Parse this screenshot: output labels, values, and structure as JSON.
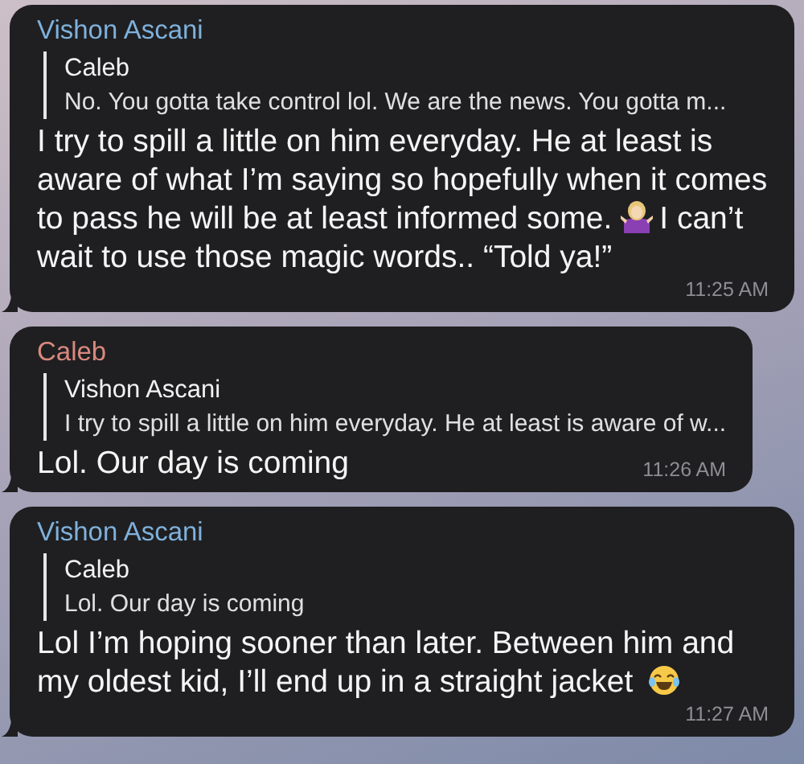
{
  "messages": [
    {
      "sender": {
        "name": "Vishon Ascani",
        "color": "#7fb1dc"
      },
      "reply": {
        "author": "Caleb",
        "text": "No. You gotta take control lol. We are the news. You gotta m..."
      },
      "body": [
        {
          "kind": "text",
          "text": "I try to spill a little on him everyday. He at least is aware of what I’m saying so hopefully when it comes to pass he will be at least informed some."
        },
        {
          "kind": "shrug"
        },
        {
          "kind": "text",
          "text": "I can’t wait to use those magic words.. “Told ya!”"
        }
      ],
      "time": "11:25 AM"
    },
    {
      "sender": {
        "name": "Caleb",
        "color": "#d9897e"
      },
      "reply": {
        "author": "Vishon Ascani",
        "text": "I try to spill a little on him everyday. He at least is aware of w..."
      },
      "body": [
        {
          "kind": "text",
          "text": "Lol. Our day is coming"
        }
      ],
      "time": "11:26 AM"
    },
    {
      "sender": {
        "name": "Vishon Ascani",
        "color": "#7fb1dc"
      },
      "reply": {
        "author": "Caleb",
        "text": "Lol. Our day is coming"
      },
      "body": [
        {
          "kind": "text",
          "text": "Lol I’m hoping sooner than later. Between him and my oldest kid, I’ll end up in a straight jacket"
        },
        {
          "kind": "laugh"
        }
      ],
      "time": "11:27 AM"
    }
  ]
}
